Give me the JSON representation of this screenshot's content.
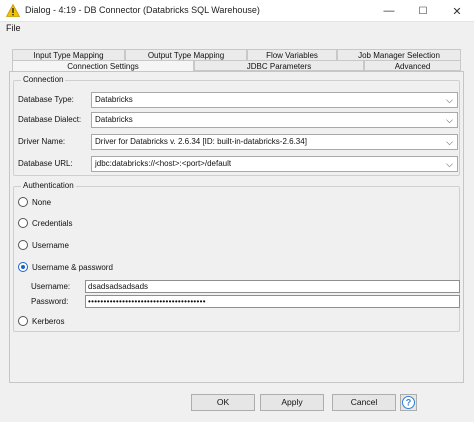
{
  "window": {
    "title": "Dialog - 4:19 - DB Connector (Databricks SQL Warehouse)",
    "minimize_glyph": "—",
    "maximize_glyph": "☐",
    "close_glyph": "✕"
  },
  "menu": {
    "file": "File"
  },
  "tabs": {
    "back_row": [
      "Input Type Mapping",
      "Output Type Mapping",
      "Flow Variables",
      "Job Manager Selection"
    ],
    "front_row": [
      "Connection Settings",
      "JDBC Parameters",
      "Advanced"
    ],
    "active": "Connection Settings"
  },
  "connection": {
    "title": "Connection",
    "database_type_label": "Database Type:",
    "database_type_value": "Databricks",
    "database_dialect_label": "Database Dialect:",
    "database_dialect_value": "Databricks",
    "driver_name_label": "Driver Name:",
    "driver_name_value": "Driver for Databricks v. 2.6.34 [ID: built-in-databricks-2.6.34]",
    "database_url_label": "Database URL:",
    "database_url_value": "jdbc:databricks://<host>:<port>/default"
  },
  "authentication": {
    "title": "Authentication",
    "options": [
      "None",
      "Credentials",
      "Username",
      "Username & password",
      "Kerberos"
    ],
    "selected": "Username & password",
    "username_label": "Username:",
    "username_value": "dsadsadsadsads",
    "password_label": "Password:",
    "password_value": "••••••••••••••••••••••••••••••••••••••"
  },
  "buttons": {
    "ok": "OK",
    "apply": "Apply",
    "cancel": "Cancel",
    "help": "?"
  },
  "colors": {
    "accent": "#1a64c8",
    "warning": "#f2c200",
    "help": "#2f7fd6"
  }
}
